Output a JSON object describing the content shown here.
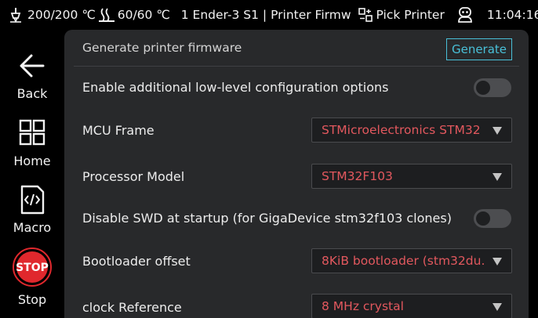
{
  "topbar": {
    "extruder_temp": "200/200 ℃",
    "bed_temp": "60/60 ℃",
    "printer_name": "1 Ender-3 S1 | Printer Firmw",
    "pick_printer": "Pick Printer",
    "time": "11:04:16"
  },
  "sidebar": {
    "back": "Back",
    "home": "Home",
    "macro": "Macro",
    "stop": "Stop",
    "stop_badge": "STOP"
  },
  "header": {
    "title": "Generate printer firmware",
    "generate": "Generate"
  },
  "settings": {
    "low_level": {
      "label": "Enable additional low-level configuration options",
      "enabled": false
    },
    "mcu_frame": {
      "label": "MCU Frame",
      "value": "STMicroelectronics STM32"
    },
    "processor": {
      "label": "Processor Model",
      "value": "STM32F103"
    },
    "swd": {
      "label": "Disable SWD at startup (for GigaDevice stm32f103 clones)",
      "enabled": false
    },
    "bootloader": {
      "label": "Bootloader offset",
      "value": "8KiB bootloader (stm32du…"
    },
    "clock": {
      "label": "clock Reference",
      "value": "8 MHz crystal"
    }
  },
  "colors": {
    "accent": "#49c0d8",
    "select_value": "#e2585e",
    "stop_red": "#e0282d",
    "panel": "#28292b"
  },
  "icons": [
    "thermometer-icon",
    "heated-bed-icon",
    "pick-printer-icon",
    "printer-robot-icon",
    "back-arrow-icon",
    "home-grid-icon",
    "macro-code-icon",
    "stop-sign-icon",
    "dropdown-arrow-icon"
  ]
}
